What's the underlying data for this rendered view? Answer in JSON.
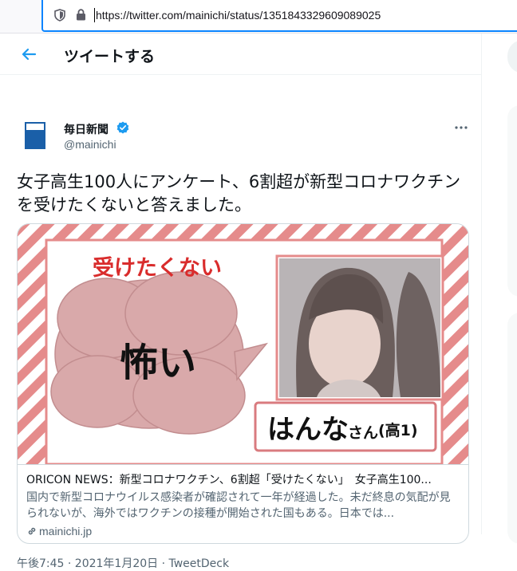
{
  "browser": {
    "url": "https://twitter.com/mainichi/status/1351843329609089025"
  },
  "header": {
    "title": "ツイートする"
  },
  "author": {
    "name": "毎日新聞",
    "handle": "@mainichi",
    "avatar_text": "毎日新聞"
  },
  "tweet": {
    "text": "女子高生100人にアンケート、6割超が新型コロナワクチンを受けたくないと答えました。",
    "timestamp": "午後7:45 · 2021年1月20日 · TweetDeck"
  },
  "card": {
    "image_text": {
      "heading": "受けたくない",
      "bubble": "怖い",
      "name": "はんな",
      "suffix": "さん",
      "grade": "(高1)"
    },
    "title": "ORICON NEWS：新型コロナワクチン、6割超「受けたくない」　女子高生100...",
    "description": "国内で新型コロナウイルス感染者が確認されて一年が経過した。未だ終息の気配が見られないが、海外ではワクチンの接種が開始された国もある。日本では...",
    "domain": "mainichi.jp"
  },
  "colors": {
    "accent": "#1d9bf0",
    "stripe": "#e58b8b",
    "cloud": "#d9a9aa",
    "heading_red": "#d92c2c"
  }
}
